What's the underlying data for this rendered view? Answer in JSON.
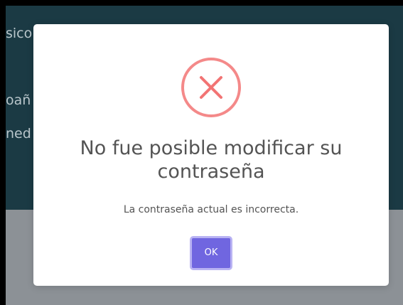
{
  "background": {
    "line1": "sico",
    "line2": "oañ",
    "line3": "ned"
  },
  "modal": {
    "icon": "error-x-icon",
    "icon_color": "#f27474",
    "title": "No fue posible modificar su contraseña",
    "message": "La contraseña actual es incorrecta.",
    "ok_label": "OK",
    "button_color": "#7066e0"
  }
}
